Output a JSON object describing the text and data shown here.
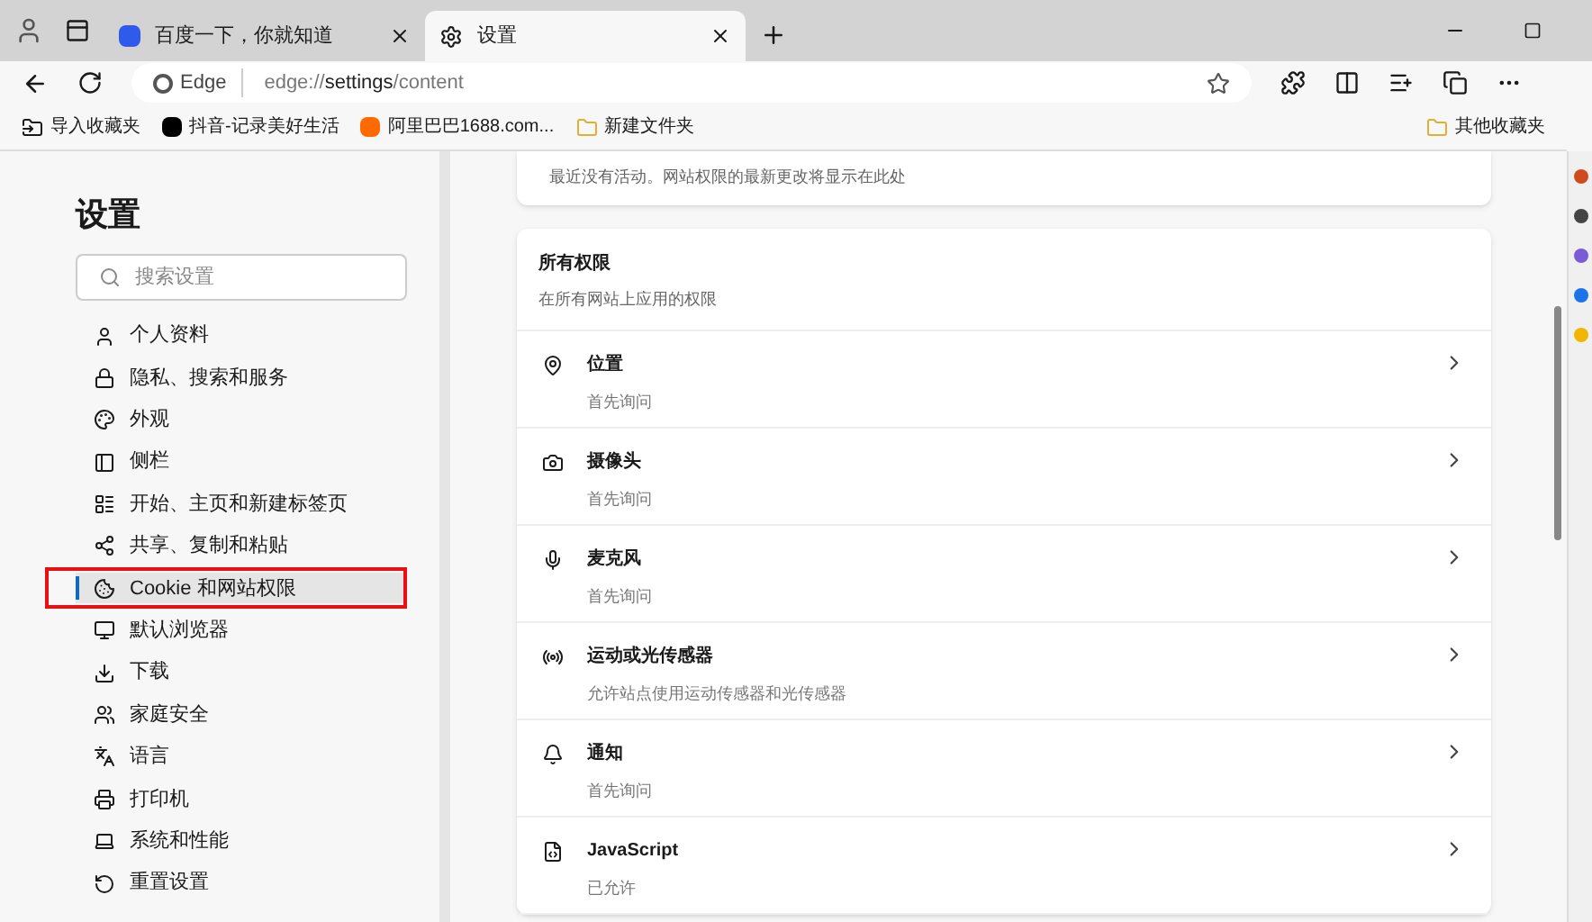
{
  "tabs": [
    {
      "title": "百度一下，你就知道",
      "selected": false
    },
    {
      "title": "设置",
      "selected": true
    }
  ],
  "address": {
    "site_label": "Edge",
    "url_prefix": "edge://",
    "url_host": "settings",
    "url_path": "/content"
  },
  "bookmarks": [
    {
      "label": "导入收藏夹"
    },
    {
      "label": "抖音-记录美好生活"
    },
    {
      "label": "阿里巴巴1688.com..."
    },
    {
      "label": "新建文件夹"
    }
  ],
  "other_bookmarks": "其他收藏夹",
  "sidebar": {
    "title": "设置",
    "search_placeholder": "搜索设置",
    "items": [
      {
        "label": "个人资料",
        "selected": false
      },
      {
        "label": "隐私、搜索和服务",
        "selected": false
      },
      {
        "label": "外观",
        "selected": false
      },
      {
        "label": "侧栏",
        "selected": false
      },
      {
        "label": "开始、主页和新建标签页",
        "selected": false
      },
      {
        "label": "共享、复制和粘贴",
        "selected": false
      },
      {
        "label": "Cookie 和网站权限",
        "selected": true
      },
      {
        "label": "默认浏览器",
        "selected": false
      },
      {
        "label": "下载",
        "selected": false
      },
      {
        "label": "家庭安全",
        "selected": false
      },
      {
        "label": "语言",
        "selected": false
      },
      {
        "label": "打印机",
        "selected": false
      },
      {
        "label": "系统和性能",
        "selected": false
      },
      {
        "label": "重置设置",
        "selected": false
      }
    ]
  },
  "recent_activity": "最近没有活动。网站权限的最新更改将显示在此处",
  "permissions": {
    "title": "所有权限",
    "subtitle": "在所有网站上应用的权限",
    "items": [
      {
        "name": "位置",
        "status": "首先询问"
      },
      {
        "name": "摄像头",
        "status": "首先询问"
      },
      {
        "name": "麦克风",
        "status": "首先询问"
      },
      {
        "name": "运动或光传感器",
        "status": "允许站点使用运动传感器和光传感器"
      },
      {
        "name": "通知",
        "status": "首先询问"
      },
      {
        "name": "JavaScript",
        "status": "已允许"
      }
    ]
  }
}
